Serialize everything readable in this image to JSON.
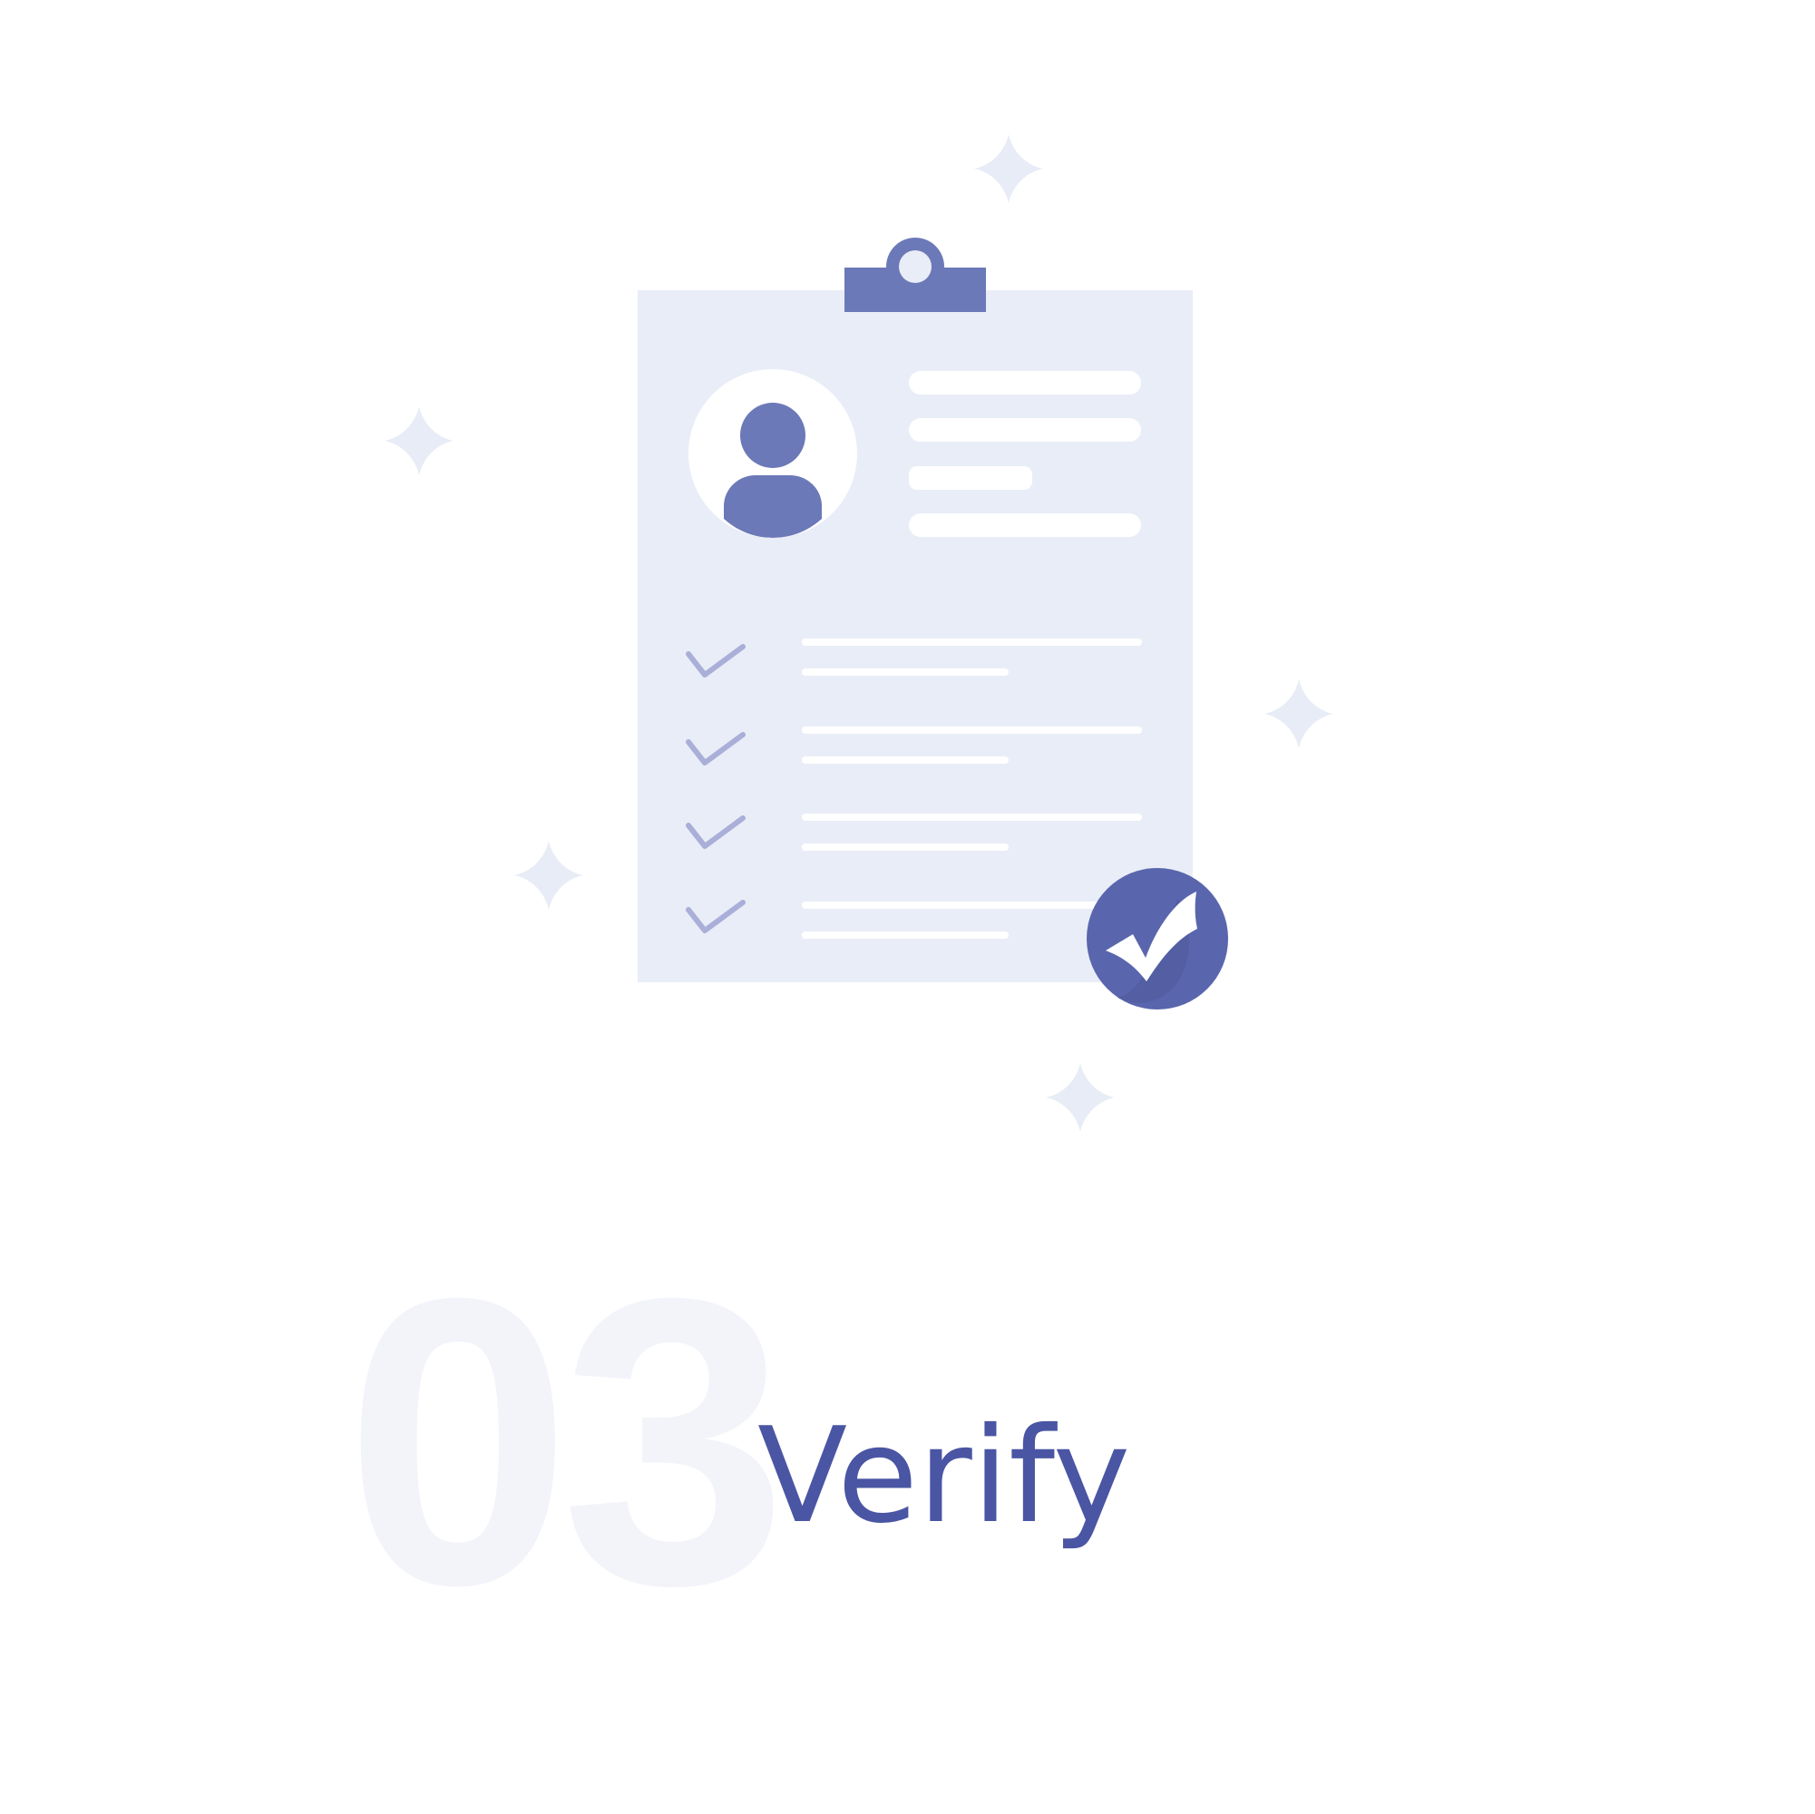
{
  "step": {
    "number": "03",
    "title": "Verify"
  },
  "icons": {
    "clipboard": "clipboard-icon",
    "avatar": "user-avatar-icon",
    "checkmark": "checkmark-icon",
    "verified_badge": "verified-badge-icon",
    "sparkle": "sparkle-icon"
  },
  "colors": {
    "background": "#ffffff",
    "clipboard_paper": "#e9edf7",
    "clip": "#6c79b8",
    "accent": "#4a55a3",
    "checkmark": "#a9afd8",
    "badge": "#5966ad",
    "number_watermark": "#f3f4fa",
    "sparkle": "#e8ecf6"
  }
}
